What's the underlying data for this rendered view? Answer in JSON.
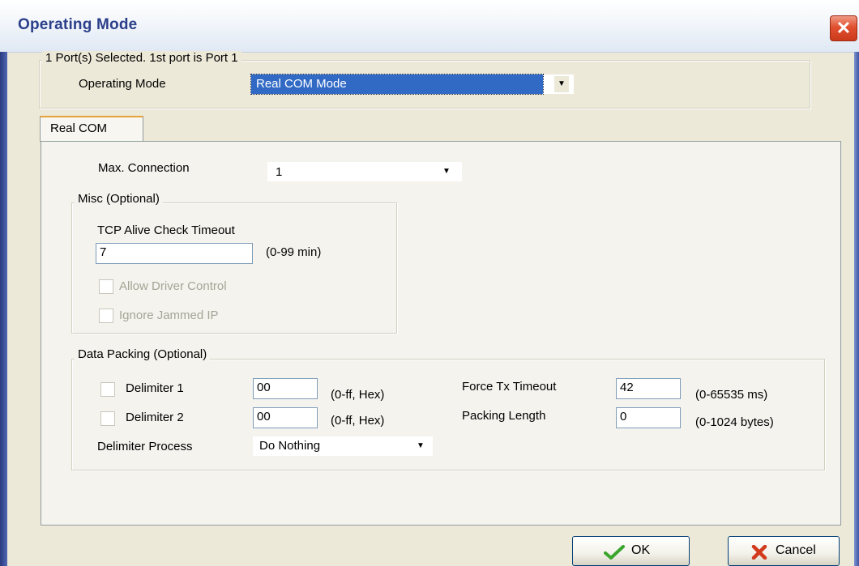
{
  "window": {
    "title": "Operating Mode",
    "close_glyph": "✕"
  },
  "selection": {
    "caption": "1 Port(s) Selected. 1st port is Port 1",
    "mode_label": "Operating Mode",
    "mode_value": "Real COM Mode"
  },
  "tabs": [
    {
      "label": "Real COM",
      "active": true
    }
  ],
  "real_com": {
    "max_connection_label": "Max. Connection",
    "max_connection_value": "1",
    "misc": {
      "title": "Misc (Optional)",
      "tcp_label": "TCP Alive Check Timeout",
      "tcp_value": "7",
      "tcp_unit": "(0-99 min)",
      "allow_driver_control": "Allow Driver Control",
      "ignore_jammed_ip": "Ignore Jammed IP"
    },
    "packing": {
      "title": "Data Packing (Optional)",
      "delimiter1_label": "Delimiter 1",
      "delimiter1_value": "00",
      "delimiter1_unit": "(0-ff, Hex)",
      "delimiter2_label": "Delimiter 2",
      "delimiter2_value": "00",
      "delimiter2_unit": "(0-ff, Hex)",
      "process_label": "Delimiter Process",
      "process_value": "Do Nothing",
      "force_tx_label": "Force Tx Timeout",
      "force_tx_value": "42",
      "force_tx_unit": "(0-65535 ms)",
      "packing_length_label": "Packing Length",
      "packing_length_value": "0",
      "packing_length_unit": "(0-1024 bytes)"
    }
  },
  "buttons": {
    "ok": "OK",
    "cancel": "Cancel"
  },
  "colors": {
    "title_text": "#2b3f8a",
    "selection_highlight": "#316ac5",
    "ok_check": "#3aa62c",
    "cancel_x": "#d23a1c"
  }
}
